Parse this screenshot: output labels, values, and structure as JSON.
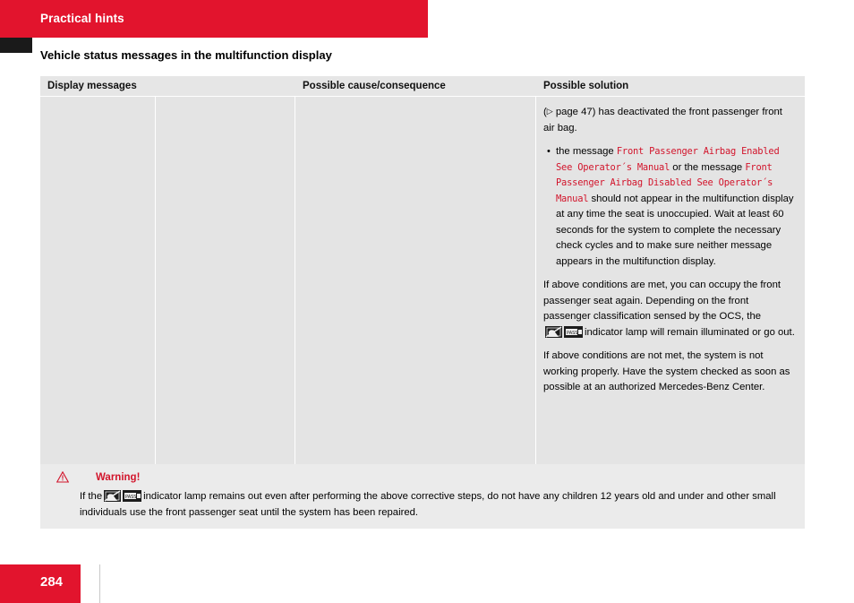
{
  "header": {
    "chapter_title": "Practical hints",
    "section_title": "Vehicle status messages in the multifunction display",
    "bar_color": "#e2142d"
  },
  "table": {
    "columns": [
      {
        "label": "Display messages"
      },
      {
        "label": ""
      },
      {
        "label": "Possible cause/consequence"
      },
      {
        "label": "Possible solution"
      }
    ],
    "solution": {
      "para1_prefix": "(",
      "para1_tri": "▷",
      "para1_text": " page 47) has deactivated the front passenger front air bag.",
      "bullet_dot": "•",
      "bullet_lead": "the message ",
      "bullet_msg1": "Front Passenger Airbag Enabled See Operator´s Manual",
      "bullet_mid": " or the message ",
      "bullet_msg2": "Front Passenger Airbag Disabled See Operator´s Manual",
      "bullet_tail": " should not appear in the multifunction display at any time the seat is unoccupied. Wait at least 60 seconds for the system to complete the necessary check cycles and to make sure neither message appears in the multifunction display.",
      "para2": "If above conditions are met, you can occupy the front passenger seat again. Depending on the front passenger classification sensed by the OCS, the",
      "para2_tail": "indicator lamp will remain illuminated or go out.",
      "para3": "If above conditions are not met, the system is not working properly. Have the system checked as soon as possible at an authorized Mercedes-Benz Center."
    }
  },
  "warning": {
    "title": "Warning!",
    "icon": "warning-triangle-icon",
    "text_before_lamp": "If the",
    "text_after_lamp": "indicator lamp remains out even after performing the above corrective steps, do not have any children 12 years old and under and other small individuals use the front passenger seat until the system has been repaired.",
    "title_color": "#d2142b"
  },
  "footer": {
    "page_number": "284"
  }
}
